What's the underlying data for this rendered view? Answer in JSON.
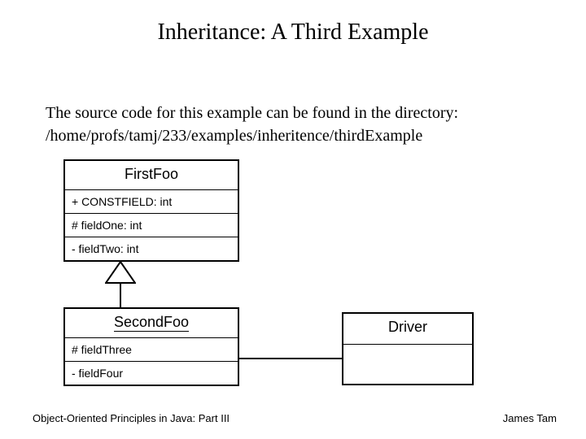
{
  "title": "Inheritance: A Third Example",
  "intro_line1": "The source code for this example can be found in the directory:",
  "intro_line2": "/home/profs/tamj/233/examples/inheritence/thirdExample",
  "classes": {
    "firstFoo": {
      "name": "FirstFoo",
      "attr1": "+ CONSTFIELD: int",
      "attr2": "# fieldOne: int",
      "attr3": "- fieldTwo: int"
    },
    "secondFoo": {
      "name": "SecondFoo",
      "attr1": "# fieldThree",
      "attr2": "- fieldFour"
    },
    "driver": {
      "name": "Driver"
    }
  },
  "footer": {
    "left": "Object-Oriented Principles in Java: Part III",
    "right": "James Tam"
  }
}
